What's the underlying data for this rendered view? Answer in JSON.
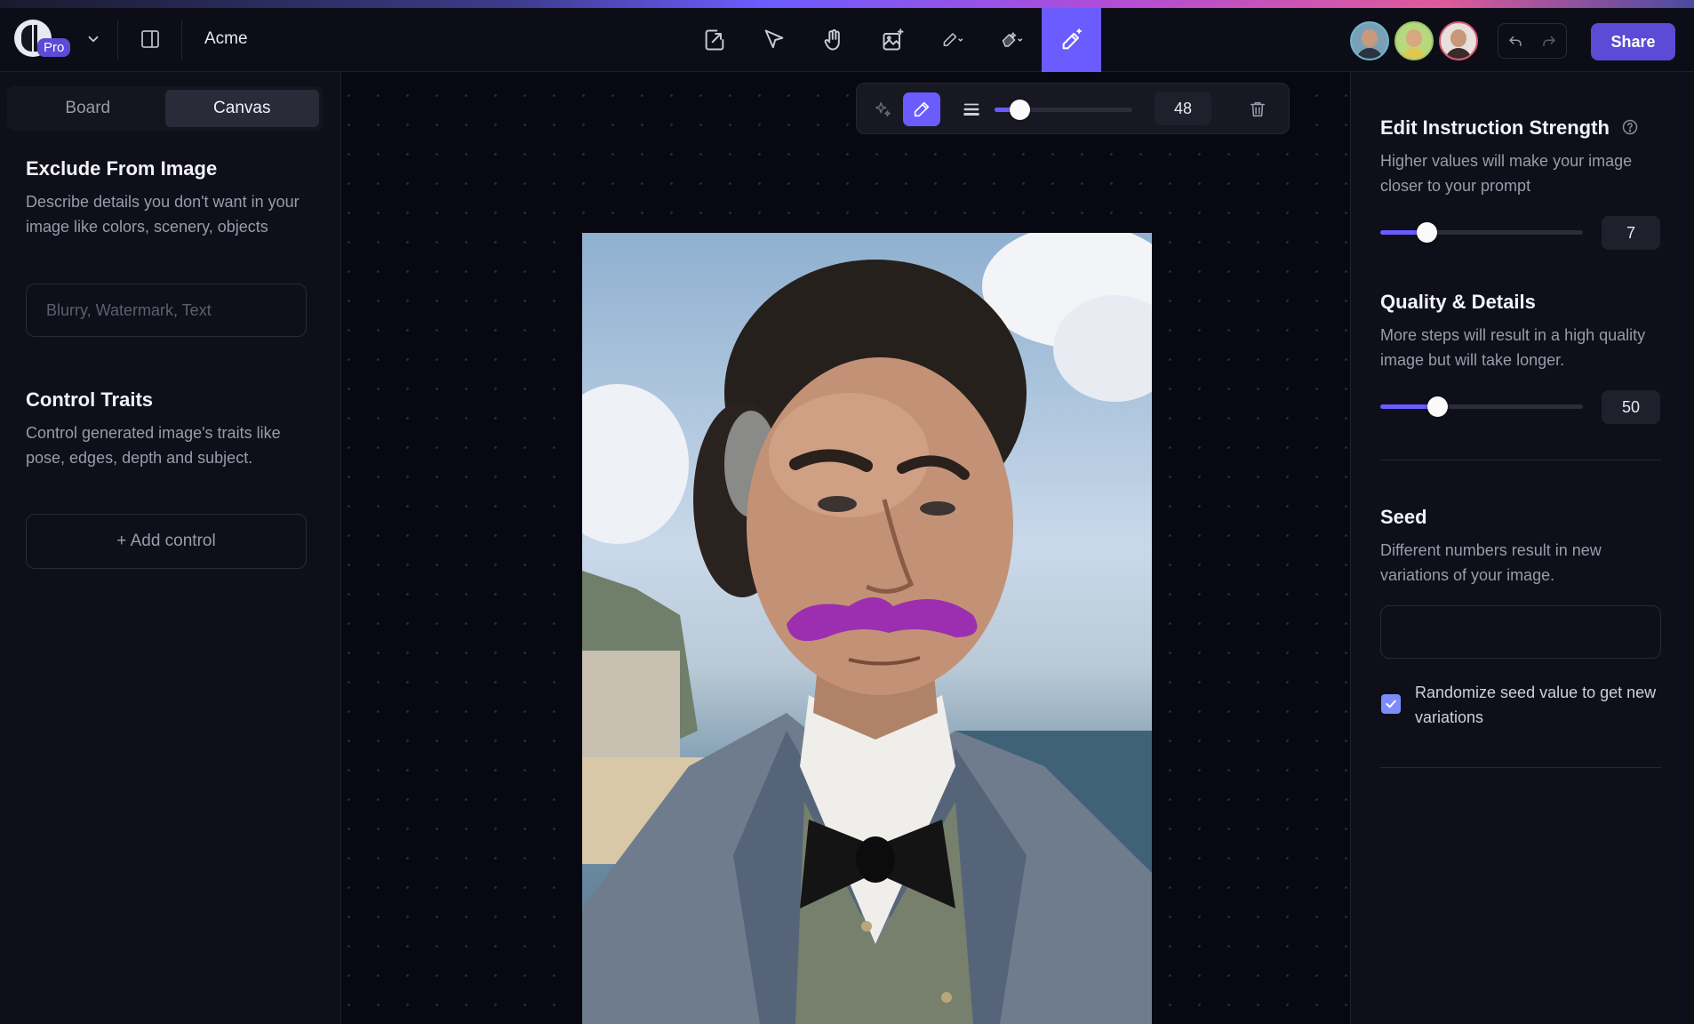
{
  "header": {
    "project_name": "Acme",
    "pro_label": "Pro",
    "share_label": "Share",
    "tools": [
      "upload-icon",
      "cursor-icon",
      "hand-icon",
      "image-magic-icon",
      "pencil-icon",
      "eraser-magic-icon",
      "magic-brush-icon"
    ],
    "active_tool": "magic-brush-icon"
  },
  "left_panel": {
    "tabs": {
      "board": "Board",
      "canvas": "Canvas"
    },
    "active_tab": "Canvas",
    "exclude": {
      "title": "Exclude From Image",
      "description": "Describe details you don't want in your image like colors, scenery, objects",
      "placeholder": "Blurry, Watermark, Text"
    },
    "control": {
      "title": "Control Traits",
      "description": "Control generated image's traits like pose, edges, depth and subject.",
      "add_label": "+ Add control"
    }
  },
  "brush_bar": {
    "size_value": "48",
    "size_fraction": 0.18
  },
  "right_panel": {
    "strength": {
      "title": "Edit Instruction Strength",
      "description": "Higher values will make your image closer to your prompt",
      "value": "7",
      "fraction": 0.23
    },
    "quality": {
      "title": "Quality & Details",
      "description": "More steps will result in a high quality image but will take longer.",
      "value": "50",
      "fraction": 0.28
    },
    "seed": {
      "title": "Seed",
      "description": "Different numbers result in new variations of your image.",
      "value": "",
      "randomize_label": "Randomize seed value to get new variations",
      "randomize_checked": true
    }
  },
  "colors": {
    "accent": "#6a5cff",
    "mustache": "#9b2fb0"
  }
}
